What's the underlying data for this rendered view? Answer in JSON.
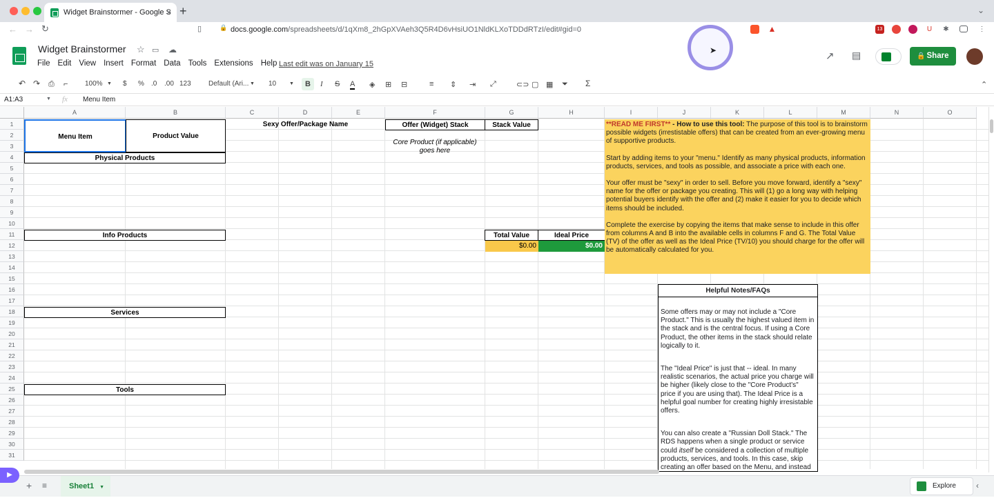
{
  "browser": {
    "tab_title": "Widget Brainstormer - Google S",
    "tab_close": "×",
    "new_tab": "+",
    "url_host": "docs.google.com",
    "url_path": "/spreadsheets/d/1qXm8_2hGpXVAeh3Q5R4D6vHsiUO1NldKLXoTDDdRTzI/edit#gid=0",
    "ext_badge": "13"
  },
  "app": {
    "doc_title": "Widget Brainstormer",
    "menus": [
      "File",
      "Edit",
      "View",
      "Insert",
      "Format",
      "Data",
      "Tools",
      "Extensions",
      "Help"
    ],
    "last_edit": "Last edit was on January 15",
    "share_label": "Share"
  },
  "toolbar": {
    "zoom": "100%",
    "currency": "$",
    "percent": "%",
    "dec_minus": ".0",
    "dec_plus": ".00",
    "more_formats": "123",
    "font": "Default (Ari...",
    "font_size": "10",
    "bold": "B",
    "italic": "I",
    "strike": "S",
    "text_color": "A"
  },
  "formula_bar": {
    "name_box": "A1:A3",
    "fx": "fx",
    "content": "Menu Item"
  },
  "columns": [
    "A",
    "B",
    "C",
    "D",
    "E",
    "F",
    "G",
    "H",
    "I",
    "J",
    "K",
    "L",
    "M",
    "N",
    "O"
  ],
  "rows": [
    "1",
    "2",
    "3",
    "4",
    "5",
    "6",
    "7",
    "8",
    "9",
    "10",
    "11",
    "12",
    "13",
    "14",
    "15",
    "16",
    "17",
    "18",
    "19",
    "20",
    "21",
    "22",
    "23",
    "24",
    "25",
    "26",
    "27",
    "28",
    "29",
    "30",
    "31"
  ],
  "cells": {
    "menu_item": "Menu Item",
    "product_value": "Product Value",
    "physical_products": "Physical Products",
    "info_products": "Info Products",
    "services": "Services",
    "tools": "Tools",
    "offer_name": "Sexy Offer/Package Name",
    "offer_stack": "Offer (Widget) Stack",
    "stack_value": "Stack Value",
    "core_product": "Core Product (if applicable) goes here",
    "total_value": "Total Value",
    "ideal_price": "Ideal Price",
    "total_value_amount": "$0.00",
    "ideal_price_amount": "$0.00"
  },
  "readme": {
    "lead_red": "**READ ME FIRST**",
    "lead_bold": " - How to use this tool:",
    "p1": " The purpose of this tool is to brainstorm possible widgets (irrestistable offers) that can be created from an ever-growing menu of supportive products.",
    "p2": "Start by adding items to your \"menu.\" Identify as many physical products, information products, services, and tools as possible, and associate a price with each one.",
    "p3": "Your offer must be \"sexy\" in order to sell. Before you move forward, identify a \"sexy\" name for the offer or package you creating. This will (1) go a long way with helping potential buyers identify with the offer and (2) make it easier for you to decide which items should be included.",
    "p4": "Complete the exercise by copying the items that make sense to include in this offer from columns A and B into the available cells in columns F and G. The Total Value (TV) of the offer as well as the Ideal Price (TV/10) you should charge for the offer will be automatically calculated for you."
  },
  "notes": {
    "title": "Helpful Notes/FAQs",
    "p1": "Some offers may or may not include a \"Core Product.\" This is usually the highest valued item in the stack and is the central focus. If using a Core Product, the other items in the stack should relate logically to it.",
    "p2": "The \"Ideal Price\" is just that -- ideal. In many realistic scenarios, the actual price you charge will be higher (likely close to the \"Core Product's\" price if you are using that). The Ideal Price is a helpful goal number for creating highly irresistable offers.",
    "p3a": "You can also create a \"Russian Doll Stack.\" The RDS happens when a single product or service could ",
    "p3i": "itself",
    "p3b": " be considered a collection of multiple products, services, and tools. In this case, skip creating an offer based on the Menu, and instead"
  },
  "bottom": {
    "sheet_name": "Sheet1",
    "explore": "Explore"
  },
  "colors": {
    "readme_bg": "#fbd35e",
    "total_value_bg": "#f9c84a",
    "ideal_price_bg": "#1e9a3c",
    "share_bg": "#1e8e3e",
    "accent_red": "#c0392b"
  }
}
